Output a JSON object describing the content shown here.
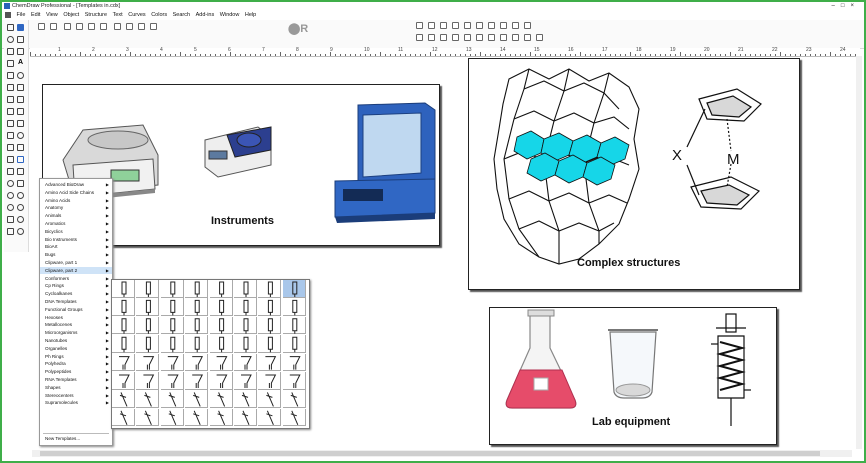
{
  "app": {
    "title": "ChemDraw Professional - [Templates in.cdx]",
    "window_controls": [
      "–",
      "□",
      "×"
    ]
  },
  "menubar": {
    "items": [
      "File",
      "Edit",
      "View",
      "Object",
      "Structure",
      "Text",
      "Curves",
      "Colors",
      "Search",
      "Add-ins",
      "Window",
      "Help"
    ]
  },
  "ruler": {
    "numbers": [
      "1",
      "2",
      "3",
      "4",
      "5",
      "6",
      "7",
      "8",
      "9",
      "10",
      "11",
      "12",
      "13",
      "14",
      "15",
      "16",
      "17",
      "18",
      "19",
      "20",
      "21",
      "22",
      "23",
      "24"
    ]
  },
  "template_menu": {
    "items": [
      {
        "label": "Advanced BioDraw"
      },
      {
        "label": "Amino Acid Side Chains"
      },
      {
        "label": "Amino Acids"
      },
      {
        "label": "Anatomy"
      },
      {
        "label": "Animals"
      },
      {
        "label": "Aromatics"
      },
      {
        "label": "Bicyclics"
      },
      {
        "label": "Bio Instruments"
      },
      {
        "label": "BioArt"
      },
      {
        "label": "Bugs"
      },
      {
        "label": "Clipware, part 1"
      },
      {
        "label": "Clipware, part 2",
        "selected": true
      },
      {
        "label": "Conformers"
      },
      {
        "label": "Cp Rings"
      },
      {
        "label": "Cycloalkanes"
      },
      {
        "label": "DNA Templates"
      },
      {
        "label": "Functional Groups"
      },
      {
        "label": "Hexoses"
      },
      {
        "label": "Metallocenes"
      },
      {
        "label": "Microorganisms"
      },
      {
        "label": "Nanotubes"
      },
      {
        "label": "Organelles"
      },
      {
        "label": "Ph Rings"
      },
      {
        "label": "Polyhedra"
      },
      {
        "label": "Polypeptides"
      },
      {
        "label": "RNA Templates"
      },
      {
        "label": "Shapes"
      },
      {
        "label": "Stereocenters"
      },
      {
        "label": "Supramolecules"
      }
    ],
    "new_templates_label": "New Templates..."
  },
  "canvas": {
    "instruments_label": "Instruments",
    "complex_label": "Complex structures",
    "lab_label": "Lab equipment",
    "atom_x": "X",
    "atom_m": "M"
  },
  "colors": {
    "frame": "#3fae49",
    "accent": "#2e66c2",
    "nanotube_highlight": "#16d6e8",
    "flask_liquid": "#e64c6a",
    "menu_selection": "#cfe3f7"
  },
  "icons": [
    "app-icon",
    "lasso-icon",
    "marquee-icon",
    "eraser-icon",
    "text-tool-icon",
    "bond-tool-icon",
    "ring-tool-icon",
    "template-tool-icon",
    "submenu-arrow-icon"
  ]
}
